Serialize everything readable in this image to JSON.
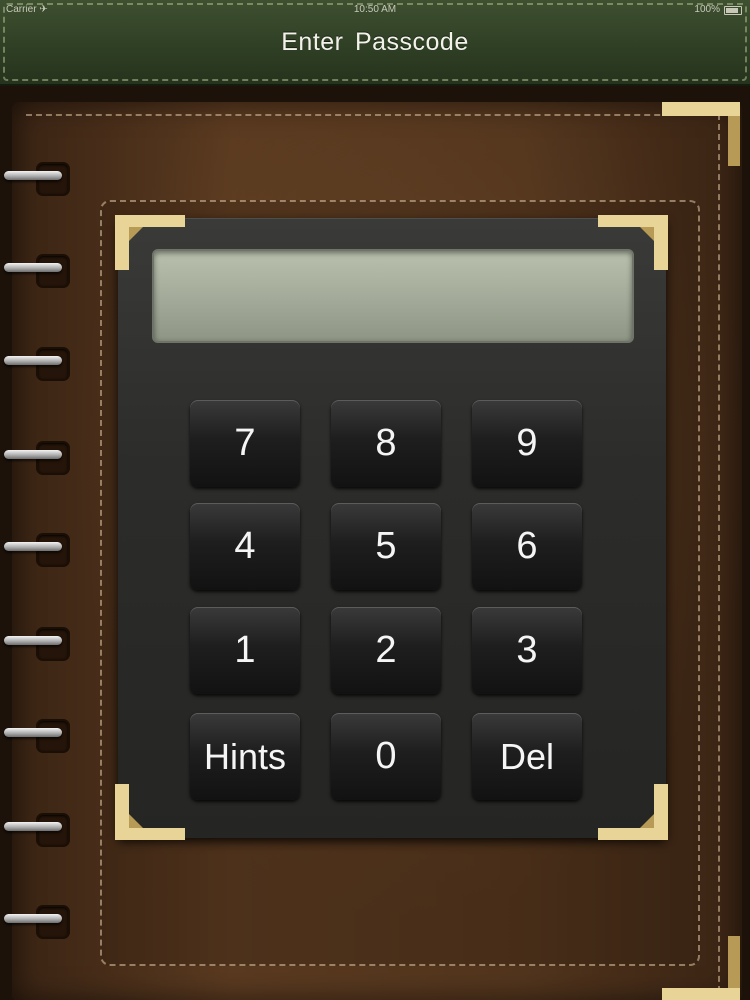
{
  "status_bar": {
    "carrier": "Carrier ✈",
    "time": "10:50 AM",
    "battery": "100%"
  },
  "header": {
    "title": "Enter  Passcode"
  },
  "passcode_display": {
    "value": ""
  },
  "keypad": {
    "rows": [
      [
        "7",
        "8",
        "9"
      ],
      [
        "4",
        "5",
        "6"
      ],
      [
        "1",
        "2",
        "3"
      ],
      [
        "Hints",
        "0",
        "Del"
      ]
    ]
  },
  "colors": {
    "header_green": "#2e3e24",
    "leather_brown": "#52351d",
    "gold": "#e8d496",
    "key_dark": "#1e1e1e",
    "display_green": "#a2a998"
  },
  "icons": {
    "battery": "battery-icon",
    "corner": "gold-corner-icon",
    "ring": "spiral-ring-icon"
  }
}
